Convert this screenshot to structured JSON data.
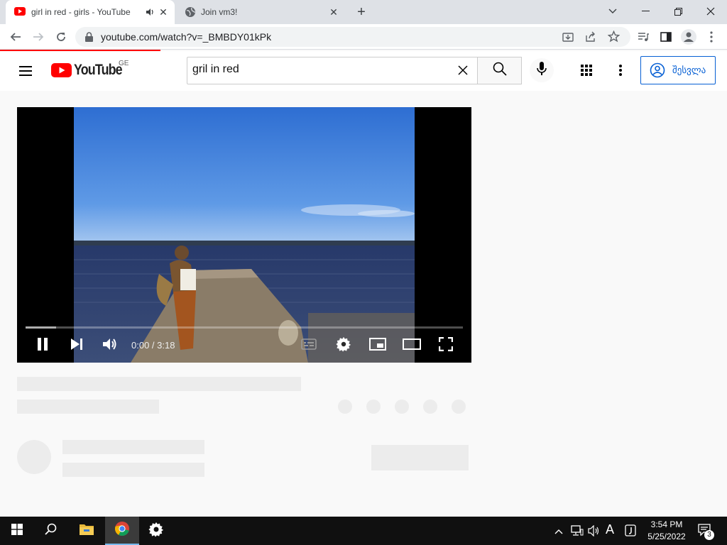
{
  "browser": {
    "tabs": [
      {
        "title": "girl in red - girls - YouTube",
        "active": true,
        "audio": true
      },
      {
        "title": "Join vm3!",
        "active": false
      }
    ],
    "url": "youtube.com/watch?v=_BMBDY01kPk"
  },
  "youtube": {
    "logo_text": "YouTube",
    "region": "GE",
    "search": {
      "value": "gril in red",
      "placeholder": "Search"
    },
    "signin_label": "შესვლა"
  },
  "player": {
    "time_display": "0:00 / 3:18",
    "progress_loaded_fraction": 0.07
  },
  "taskbar": {
    "time": "3:54 PM",
    "date": "5/25/2022",
    "notification_count": "3",
    "ime_label": "A"
  },
  "colors": {
    "accent_red": "#ff0000",
    "link_blue": "#065fd4"
  }
}
